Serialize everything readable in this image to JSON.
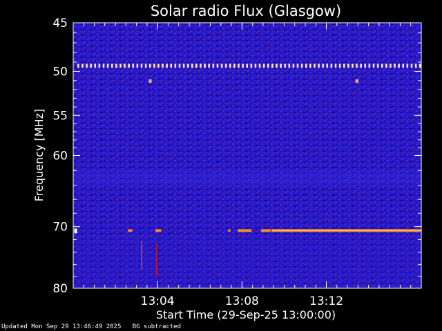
{
  "chart_data": {
    "type": "heatmap",
    "title": "Solar radio Flux (Glasgow)",
    "xlabel": "Start Time (29-Sep-25 13:00:00)",
    "ylabel": "Frequency [MHz]",
    "x_unit": "minutes after 13:00:00",
    "xlim": [
      0,
      16.5
    ],
    "x_ticks": [
      {
        "value": 4,
        "label": "13:04"
      },
      {
        "value": 8,
        "label": "13:08"
      },
      {
        "value": 12,
        "label": "13:12"
      }
    ],
    "ylim": [
      45,
      80
    ],
    "y_scale": "log",
    "y_inverted": true,
    "y_ticks": [
      45,
      50,
      55,
      60,
      70,
      80
    ],
    "y_tick_labels": [
      "45",
      "50",
      "55",
      "60",
      "70",
      "80"
    ],
    "y_minor_ticks": [
      46,
      47,
      48,
      49,
      51,
      52,
      53,
      54,
      56,
      57,
      58,
      59,
      62,
      64,
      66,
      68,
      72,
      74,
      76,
      78
    ],
    "x_minor_step": 0.5,
    "background_colors": [
      "#1a10b8",
      "#2a1fd6",
      "#3b2fe8",
      "#101090",
      "#4a22c8"
    ],
    "features": [
      {
        "name": "RFI line",
        "frequency": 49.4,
        "x_start": 0.2,
        "x_end": 16.5,
        "pattern": "dashed",
        "color": "#ffe8b0"
      },
      {
        "name": "RFI band",
        "frequency": 70.6,
        "x_start": 0.1,
        "x_end": 16.5,
        "pattern": "intermittent",
        "color": "#ff8c1a"
      },
      {
        "name": "spike",
        "frequency": 51.1,
        "x": 3.65,
        "color": "#ffb070"
      },
      {
        "name": "spike",
        "frequency": 51.1,
        "x": 13.45,
        "color": "#ffb070"
      }
    ],
    "grid": false,
    "legend": "none"
  },
  "footer": "Updated Mon Sep 29 13:46:49 2025   BG subtracted"
}
